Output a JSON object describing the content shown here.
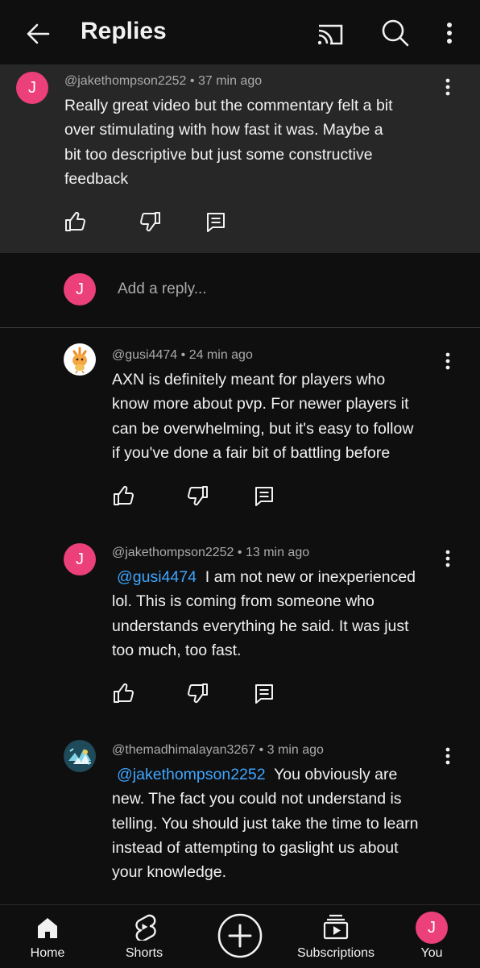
{
  "header": {
    "title": "Replies",
    "icons": [
      "back-arrow-icon",
      "cast-icon",
      "search-icon",
      "more-vert-icon"
    ]
  },
  "parent_comment": {
    "avatar_letter": "J",
    "author": "@jakethompson2252",
    "time": "37 min ago",
    "text": "Really great video but the commentary felt a bit over stimulating with how fast it was. Maybe a bit too descriptive but just some constructive feedback",
    "lines": [
      "Really great video but the commentary felt a bit",
      "over stimulating with how fast it was. Maybe a",
      "bit too descriptive but just some constructive",
      "feedback"
    ]
  },
  "reply_box": {
    "avatar_letter": "J",
    "placeholder": "Add a reply..."
  },
  "replies": [
    {
      "author": "@gusi4474",
      "time": "24 min ago",
      "avatar": "pokemon-avatar",
      "mention": "",
      "lines": [
        "AXN is definitely meant for players who",
        "know more about pvp. For newer players it",
        "can be overwhelming, but it's easy to follow",
        "if you've done a fair bit of battling before"
      ]
    },
    {
      "author": "@jakethompson2252",
      "time": "13 min ago",
      "avatar_letter": "J",
      "mention": "@gusi4474",
      "lines": [
        "I am not new or inexperienced",
        "lol. This is coming from someone who",
        "understands everything he said. It was just",
        "too much, too fast."
      ]
    },
    {
      "author": "@themadhimalayan3267",
      "time": "3 min ago",
      "avatar": "crystal-avatar",
      "mention": "@jakethompson2252",
      "lines": [
        "You obviously are",
        "new. The fact you could not understand is",
        "telling. You should just take the time to learn",
        "instead of attempting to gaslight us about",
        "your knowledge."
      ]
    }
  ],
  "nav": {
    "home": "Home",
    "shorts": "Shorts",
    "subscriptions": "Subscriptions",
    "you": "You",
    "you_avatar_letter": "J"
  },
  "colors": {
    "background": "#0f0f0f",
    "parent_background": "#272727",
    "avatar": "#ec407a",
    "mention": "#3ea6ff",
    "meta": "#aaaaaa"
  }
}
